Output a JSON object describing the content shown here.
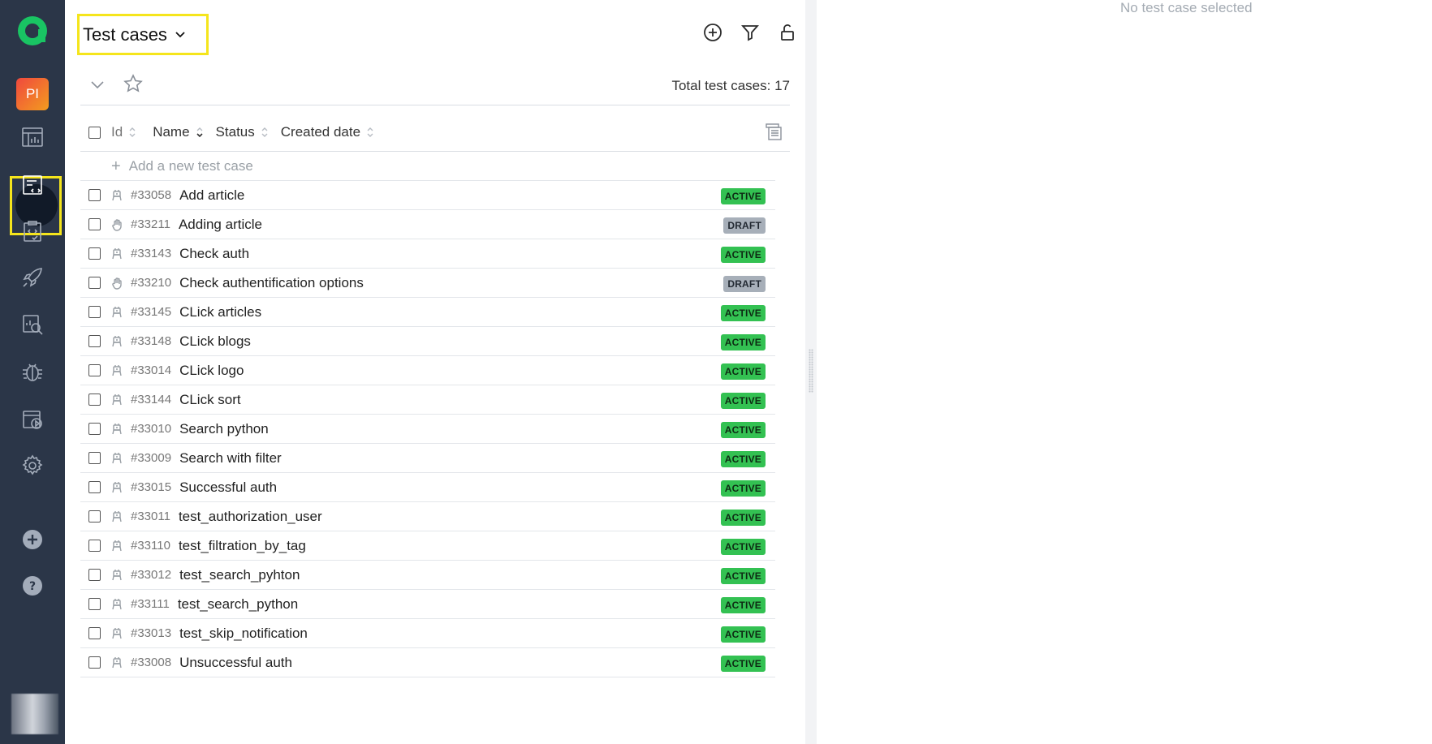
{
  "sidebar": {
    "project_initials": "PI",
    "items": [
      {
        "icon": "dashboard-icon"
      },
      {
        "icon": "test-cases-icon",
        "active": true
      },
      {
        "icon": "test-plans-icon"
      },
      {
        "icon": "launches-icon"
      },
      {
        "icon": "analytics-icon"
      },
      {
        "icon": "defects-icon"
      },
      {
        "icon": "jobs-icon"
      },
      {
        "icon": "settings-icon"
      }
    ],
    "bottom": [
      {
        "icon": "add-icon"
      },
      {
        "icon": "help-icon"
      }
    ]
  },
  "header": {
    "title": "Test cases",
    "actions": [
      "add-circle-icon",
      "filter-icon",
      "unlock-icon"
    ]
  },
  "subbar": {
    "total_label": "Total test cases: 17"
  },
  "columns": {
    "id": "Id",
    "name": "Name",
    "status": "Status",
    "created": "Created date"
  },
  "add_row": {
    "label": "Add a new test case"
  },
  "test_cases": [
    {
      "type": "automated",
      "id": "#33058",
      "name": "Add article",
      "status": "ACTIVE"
    },
    {
      "type": "manual",
      "id": "#33211",
      "name": "Adding article",
      "status": "DRAFT"
    },
    {
      "type": "automated",
      "id": "#33143",
      "name": "Check auth",
      "status": "ACTIVE"
    },
    {
      "type": "manual",
      "id": "#33210",
      "name": "Check authentification options",
      "status": "DRAFT"
    },
    {
      "type": "automated",
      "id": "#33145",
      "name": "CLick articles",
      "status": "ACTIVE"
    },
    {
      "type": "automated",
      "id": "#33148",
      "name": "CLick blogs",
      "status": "ACTIVE"
    },
    {
      "type": "automated",
      "id": "#33014",
      "name": "CLick logo",
      "status": "ACTIVE"
    },
    {
      "type": "automated",
      "id": "#33144",
      "name": "CLick sort",
      "status": "ACTIVE"
    },
    {
      "type": "automated",
      "id": "#33010",
      "name": "Search python",
      "status": "ACTIVE"
    },
    {
      "type": "automated",
      "id": "#33009",
      "name": "Search with filter",
      "status": "ACTIVE"
    },
    {
      "type": "automated",
      "id": "#33015",
      "name": "Successful auth",
      "status": "ACTIVE"
    },
    {
      "type": "automated",
      "id": "#33011",
      "name": "test_authorization_user",
      "status": "ACTIVE"
    },
    {
      "type": "automated",
      "id": "#33110",
      "name": "test_filtration_by_tag",
      "status": "ACTIVE"
    },
    {
      "type": "automated",
      "id": "#33012",
      "name": "test_search_pyhton",
      "status": "ACTIVE"
    },
    {
      "type": "automated",
      "id": "#33111",
      "name": "test_search_python",
      "status": "ACTIVE"
    },
    {
      "type": "automated",
      "id": "#33013",
      "name": "test_skip_notification",
      "status": "ACTIVE"
    },
    {
      "type": "automated",
      "id": "#33008",
      "name": "Unsuccessful auth",
      "status": "ACTIVE"
    }
  ],
  "detail": {
    "empty_label": "No test case selected"
  },
  "colors": {
    "sidebar_bg": "#2b3648",
    "highlight": "#f5e51c",
    "active_badge": "#33c152",
    "draft_badge": "#a7afb9"
  }
}
